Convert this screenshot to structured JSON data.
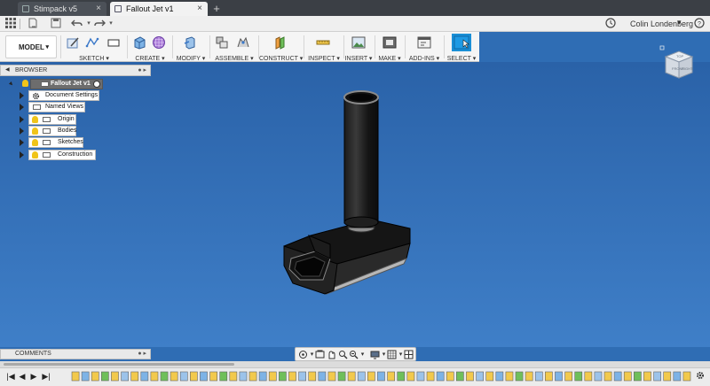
{
  "tabs": [
    {
      "label": "Stimpack v5",
      "close": "×",
      "active": false
    },
    {
      "label": "Fallout Jet v1",
      "close": "×",
      "active": true
    }
  ],
  "tab_add": "+",
  "quick_access": {
    "grid_icon": "grid-icon",
    "file_icon": "file-icon",
    "save_icon": "save-icon",
    "undo_icon": "undo-icon",
    "redo_icon": "redo-icon",
    "clock_icon": "clock-icon",
    "user_name": "Colin Londenberg",
    "user_caret": "▾",
    "help_icon": "help-icon"
  },
  "toolbar": {
    "workspace": "MODEL",
    "workspace_caret": "▾",
    "groups": [
      {
        "label": "SKETCH ▾"
      },
      {
        "label": "CREATE ▾"
      },
      {
        "label": "MODIFY ▾"
      },
      {
        "label": "ASSEMBLE ▾"
      },
      {
        "label": "CONSTRUCT ▾"
      },
      {
        "label": "INSPECT ▾"
      },
      {
        "label": "INSERT ▾"
      },
      {
        "label": "MAKE ▾"
      },
      {
        "label": "ADD-INS ▾"
      },
      {
        "label": "SELECT ▾"
      }
    ]
  },
  "browser": {
    "title": "BROWSER",
    "controls": "● ▸",
    "root": "Fallout Jet v1",
    "items": [
      {
        "label": "Document Settings",
        "icon": "gear-icon"
      },
      {
        "label": "Named Views",
        "icon": "folder-icon"
      },
      {
        "label": "Origin",
        "icon": "folder-icon"
      },
      {
        "label": "Bodies",
        "icon": "folder-icon"
      },
      {
        "label": "Sketches",
        "icon": "folder-icon"
      },
      {
        "label": "Construction",
        "icon": "folder-icon"
      }
    ]
  },
  "viewcube": {
    "face_front": "FRONT",
    "face_right": "RIGHT",
    "face_top": "TOP"
  },
  "comments": {
    "title": "COMMENTS",
    "controls": "● ▸"
  },
  "navbar": {
    "icons": [
      "orbit-icon",
      "pan-icon",
      "look-at-icon",
      "zoom-icon",
      "fit-icon",
      "display-icon",
      "grid-icon",
      "viewports-icon"
    ]
  },
  "timeline": {
    "controls": [
      "|◀",
      "◀",
      "▶",
      "▶|"
    ],
    "feature_count": 63,
    "gear_icon": "gear-icon"
  },
  "colors": {
    "viewport_top": "#2a62a8",
    "viewport_bottom": "#3f7fc8",
    "select_active": "#1a8fd6"
  }
}
